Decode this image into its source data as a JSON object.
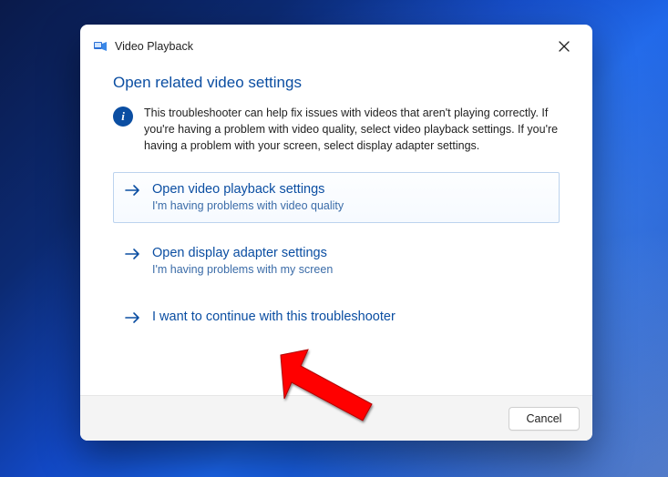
{
  "window": {
    "title": "Video Playback"
  },
  "section": {
    "heading": "Open related video settings",
    "intro": "This troubleshooter can help fix issues with videos that aren't playing correctly. If you're having a problem with video quality, select video playback settings. If you're having a problem with your screen, select display adapter settings."
  },
  "options": {
    "playback": {
      "title": "Open video playback settings",
      "sub": "I'm having problems with video quality"
    },
    "display": {
      "title": "Open display adapter settings",
      "sub": "I'm having problems with my screen"
    },
    "continue": {
      "title": "I want to continue with this troubleshooter"
    }
  },
  "footer": {
    "cancel": "Cancel"
  },
  "info_glyph": "i"
}
